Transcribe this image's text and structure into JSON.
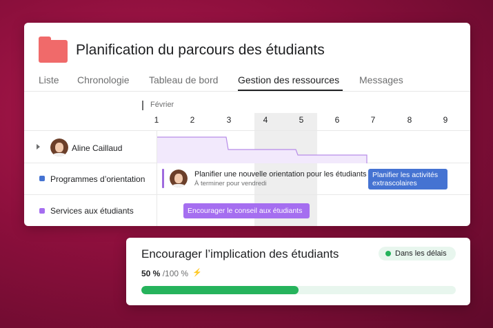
{
  "project": {
    "title": "Planification du parcours des étudiants",
    "icon": "folder-icon",
    "icon_color": "#f06a6a"
  },
  "tabs": [
    "Liste",
    "Chronologie",
    "Tableau de bord",
    "Gestion des ressources",
    "Messages"
  ],
  "active_tab": "Gestion des ressources",
  "timeline": {
    "month": "Février",
    "days": [
      "1",
      "2",
      "3",
      "4",
      "5",
      "6",
      "7",
      "8",
      "9"
    ],
    "highlighted_days": [
      "4",
      "5"
    ]
  },
  "rows": [
    {
      "label": "Aline Caillaud",
      "type": "person",
      "icon": "avatar"
    },
    {
      "label": "Programmes d’orientation",
      "type": "project",
      "color": "#4573d2"
    },
    {
      "label": "Services aux étudiants",
      "type": "project",
      "color": "#a56ef0"
    }
  ],
  "tasks": {
    "orientation": {
      "title": "Planifier une nouvelle orientation pour les étudiants",
      "subtitle": "À terminer pour vendredi"
    },
    "activities": {
      "label": "Planifier les activités extrascolaires",
      "color": "#4573d2"
    },
    "counseling": {
      "label": "Encourager le conseil aux étudiants",
      "color": "#a56ef0"
    }
  },
  "goal": {
    "title": "Encourager l’implication des étudiants",
    "status": "Dans les délais",
    "status_color": "#26b35c",
    "progress_value": "50 %",
    "progress_target": "/100 %",
    "progress_fraction": 0.5
  }
}
